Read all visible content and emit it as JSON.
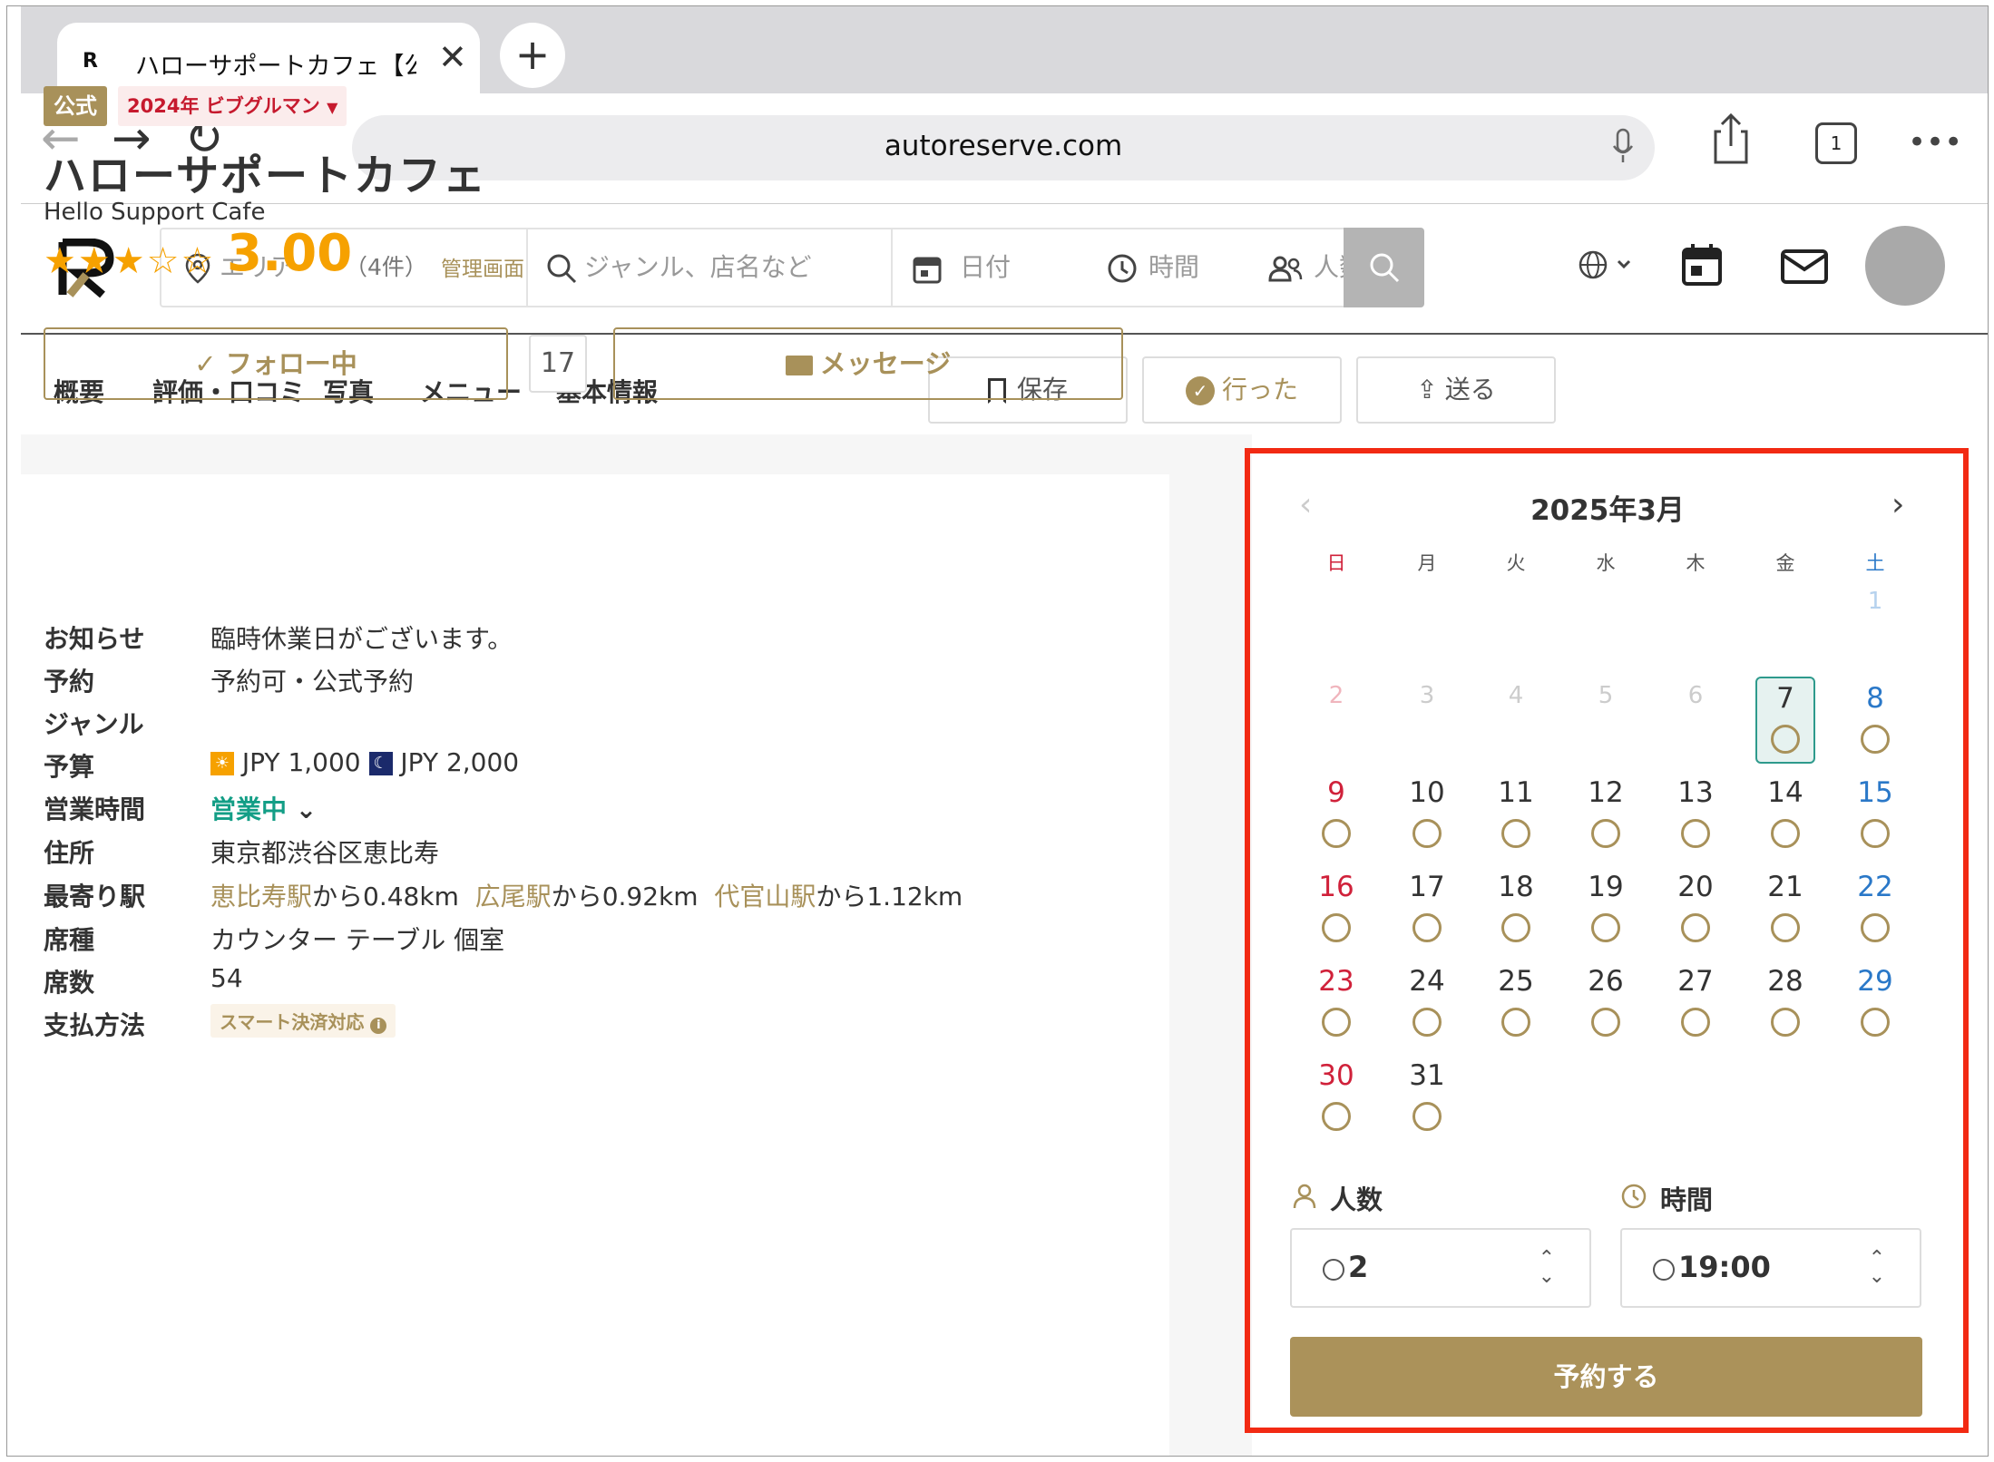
{
  "browser": {
    "tab_title": "ハローサポートカフェ【公式",
    "tab_logo": "R",
    "url": "autoreserve.com",
    "tab_count": "1"
  },
  "header": {
    "area_placeholder": "エリア",
    "genre_placeholder": "ジャンル、店名など",
    "date_placeholder": "日付",
    "time_placeholder": "時間",
    "people_placeholder": "人数"
  },
  "subnav": {
    "items": [
      "概要",
      "評価・口コミ",
      "写真",
      "メニュー",
      "基本情報"
    ],
    "save": "保存",
    "went": "行った",
    "send": "送る"
  },
  "shop": {
    "official_badge": "公式",
    "bib_badge": "2024年 ビブグルマン",
    "name": "ハローサポートカフェ",
    "name_en": "Hello Support Cafe",
    "stars": "★★★☆☆",
    "rating": "3.00",
    "review_count": "（4件）",
    "admin_link": "管理画面",
    "follow_label": "✓ フォロー中",
    "follow_count": "17",
    "message_label": "メッセージ"
  },
  "info": {
    "notice_label": "お知らせ",
    "notice_value": "臨時休業日がございます。",
    "reserve_label": "予約",
    "reserve_value": "予約可・公式予約",
    "genre_label": "ジャンル",
    "budget_label": "予算",
    "budget_lunch": "JPY 1,000",
    "budget_dinner": "JPY 2,000",
    "hours_label": "営業時間",
    "hours_value": "営業中",
    "address_label": "住所",
    "address_value": "東京都渋谷区恵比寿",
    "station_label": "最寄り駅",
    "station1": "恵比寿駅",
    "station1_dist": "から0.48km",
    "station2": "広尾駅",
    "station2_dist": "から0.92km",
    "station3": "代官山駅",
    "station3_dist": "から1.12km",
    "seat_type_label": "席種",
    "seat_type_value": "カウンター テーブル 個室",
    "seats_label": "席数",
    "seats_value": "54",
    "payment_label": "支払方法",
    "payment_value": "スマート決済対応"
  },
  "calendar": {
    "month": "2025年3月",
    "weekdays": [
      "日",
      "月",
      "火",
      "水",
      "木",
      "金",
      "土"
    ],
    "selected_day": "7",
    "people_label": "人数",
    "people_value": "2",
    "time_label": "時間",
    "time_value": "19:00",
    "reserve_button": "予約する"
  },
  "colors": {
    "accent_gold": "#ab925a",
    "highlight_red": "#f22a13",
    "sunday_red": "#d0213a",
    "saturday_blue": "#2a78c8",
    "selected_teal": "#2e9a8c"
  }
}
